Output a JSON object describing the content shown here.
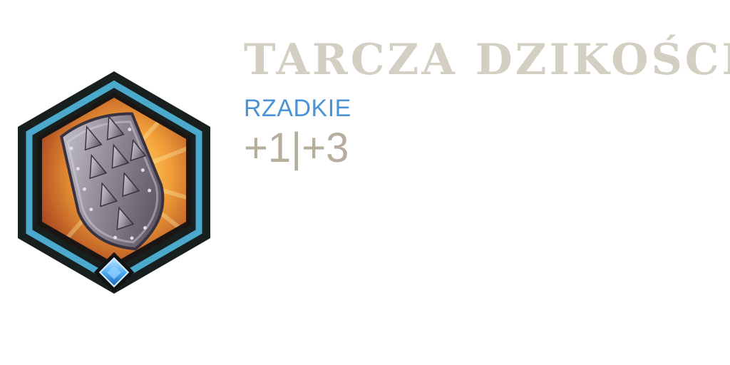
{
  "item": {
    "name": "TARCZA DZIKOŚCI",
    "rarity": "RZADKIE",
    "stats": "+1|+3",
    "icon": "spiked-shield-icon",
    "gem_icon": "blue-gem-icon"
  },
  "colors": {
    "title": "#d3cfc3",
    "rarity": "#4b93d4",
    "stats": "#b6ad9d",
    "frame_outer": "#18201f",
    "frame_ring": "#4ba9cc",
    "gem": "#4aa8f0"
  }
}
